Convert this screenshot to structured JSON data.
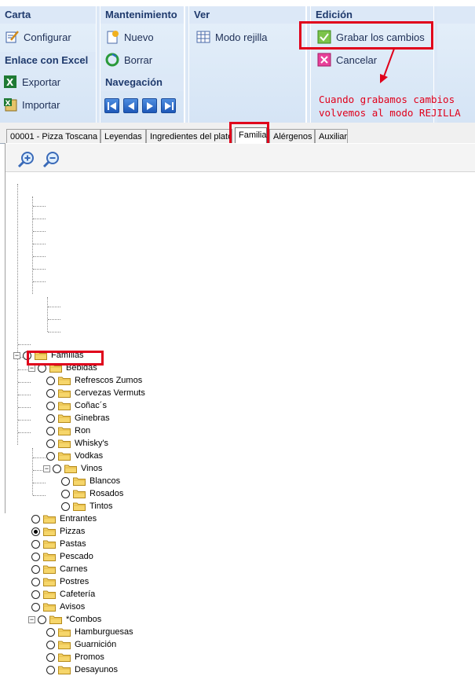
{
  "ribbon": {
    "carta": {
      "title": "Carta",
      "configurar": "Configurar"
    },
    "excel": {
      "title": "Enlace con Excel",
      "exportar": "Exportar",
      "importar": "Importar"
    },
    "mantenimiento": {
      "title": "Mantenimiento",
      "nuevo": "Nuevo",
      "borrar": "Borrar"
    },
    "navegacion": {
      "title": "Navegación"
    },
    "ver": {
      "title": "Ver",
      "modo_rejilla": "Modo rejilla"
    },
    "edicion": {
      "title": "Edición",
      "grabar": "Grabar los cambios",
      "cancelar": "Cancelar"
    }
  },
  "annotation": {
    "line1": "Cuando grabamos cambios",
    "line2": "volvemos al modo REJILLA"
  },
  "tabs": [
    "00001 - Pizza Toscana",
    "Leyendas",
    "Ingredientes del plato",
    "Familia",
    "Alérgenos",
    "Auxiliar"
  ],
  "active_tab": "Familia",
  "tree": {
    "root": "Famílias",
    "bebidas": "Bebidas",
    "bebidas_items": [
      "Refrescos Zumos",
      "Cervezas Vermuts",
      "Coñac´s",
      "Ginebras",
      "Ron",
      "Whisky's",
      "Vodkas"
    ],
    "vinos": "Vinos",
    "vinos_items": [
      "Blancos",
      "Rosados",
      "Tintos"
    ],
    "top_items": [
      "Entrantes",
      "Pizzas",
      "Pastas",
      "Pescado",
      "Carnes",
      "Postres",
      "Cafetería",
      "Avisos"
    ],
    "combos": "*Combos",
    "combos_items": [
      "Hamburguesas",
      "Guarnición",
      "Promos",
      "Desayunos"
    ],
    "selected": "Pizzas"
  },
  "colors": {
    "highlight": "#e0001b",
    "ribbon_header": "#1f3a6d"
  }
}
